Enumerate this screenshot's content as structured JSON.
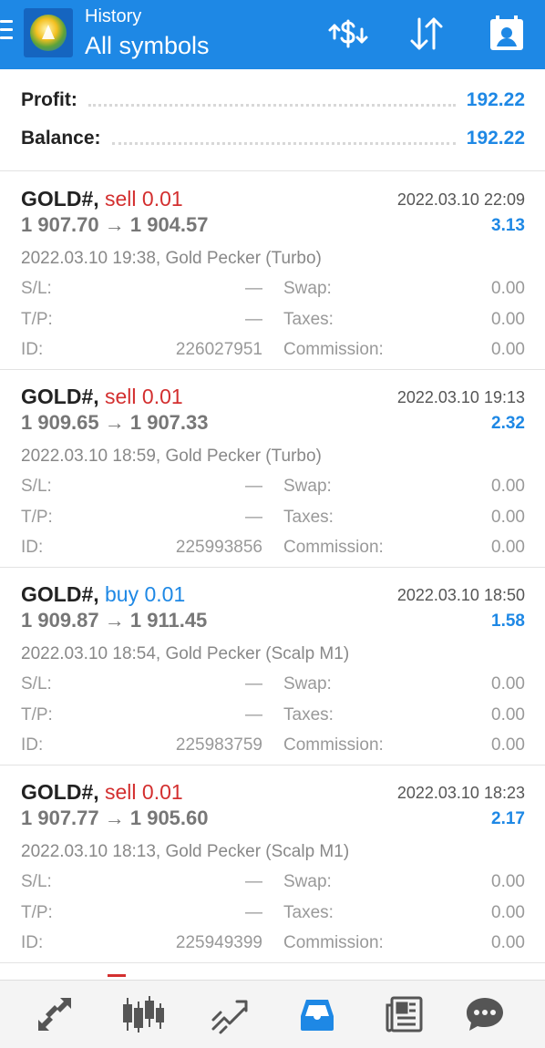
{
  "header": {
    "title_small": "History",
    "title_big": "All symbols",
    "accent_color": "#1e88e5",
    "icons": [
      "menu-icon",
      "app-logo",
      "currency-exchange-icon",
      "sort-icon",
      "account-icon"
    ]
  },
  "summary": {
    "profit_label": "Profit:",
    "profit_value": "192.22",
    "balance_label": "Balance:",
    "balance_value": "192.22"
  },
  "labels": {
    "sl": "S/L:",
    "tp": "T/P:",
    "id": "ID:",
    "swap": "Swap:",
    "taxes": "Taxes:",
    "commission": "Commission:"
  },
  "deals": [
    {
      "symbol": "GOLD#,",
      "side": "sell 0.01",
      "close_time": "2022.03.10 22:09",
      "prices": "1 907.70 → 1 904.57",
      "profit": "3.13",
      "comment": "2022.03.10 19:38, Gold Pecker (Turbo)",
      "sl": "—",
      "tp": "—",
      "id": "226027951",
      "swap": "0.00",
      "taxes": "0.00",
      "commission": "0.00"
    },
    {
      "symbol": "GOLD#,",
      "side": "sell 0.01",
      "close_time": "2022.03.10 19:13",
      "prices": "1 909.65 → 1 907.33",
      "profit": "2.32",
      "comment": "2022.03.10 18:59, Gold Pecker (Turbo)",
      "sl": "—",
      "tp": "—",
      "id": "225993856",
      "swap": "0.00",
      "taxes": "0.00",
      "commission": "0.00"
    },
    {
      "symbol": "GOLD#,",
      "side": "buy 0.01",
      "close_time": "2022.03.10 18:50",
      "prices": "1 909.87 → 1 911.45",
      "profit": "1.58",
      "comment": "2022.03.10 18:54, Gold Pecker (Scalp M1)",
      "sl": "—",
      "tp": "—",
      "id": "225983759",
      "swap": "0.00",
      "taxes": "0.00",
      "commission": "0.00"
    },
    {
      "symbol": "GOLD#,",
      "side": "sell 0.01",
      "close_time": "2022.03.10 18:23",
      "prices": "1 907.77 → 1 905.60",
      "profit": "2.17",
      "comment": "2022.03.10 18:13, Gold Pecker (Scalp M1)",
      "sl": "—",
      "tp": "—",
      "id": "225949399",
      "swap": "0.00",
      "taxes": "0.00",
      "commission": "0.00"
    }
  ],
  "bottom_nav": {
    "items": [
      "quotes-icon",
      "chart-icon",
      "trade-icon",
      "history-icon",
      "news-icon",
      "chat-icon"
    ],
    "active": "history-icon",
    "active_color": "#1e88e5",
    "inactive_color": "#555555"
  }
}
